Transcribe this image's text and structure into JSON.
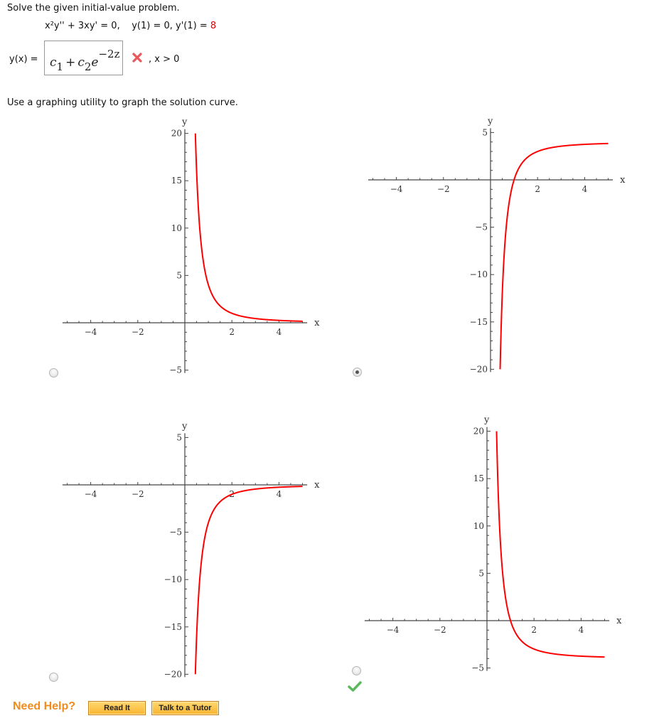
{
  "question": {
    "prompt": "Solve the given initial-value problem.",
    "equation": "x²y'' + 3xy' = 0,",
    "initial_conditions": "y(1) = 0, y'(1) = ",
    "initial_condition_highlight": "8",
    "answer_label": "y(x) =",
    "answer": {
      "c1": "c",
      "c1_sub": "1",
      "plus": "+",
      "c2": "c",
      "c2_sub": "2",
      "base": "e",
      "exponent": "−2z"
    },
    "answer_status": "incorrect",
    "domain_note": ", x > 0",
    "graph_prompt": "Use a graphing utility to graph the solution curve."
  },
  "colors": {
    "curve": "#ff0000",
    "wrong": "#e8585a",
    "correct": "#5cb85c",
    "help_text": "#f08c1e"
  },
  "chart_data": [
    {
      "type": "line",
      "option_index": 1,
      "selected": false,
      "correct": false,
      "function": "y = 4/x^2",
      "xlabel": "x",
      "ylabel": "y",
      "xlim": [
        -5.2,
        5.2
      ],
      "ylim": [
        -5,
        20
      ],
      "x_ticks": [
        -4,
        -2,
        2,
        4
      ],
      "y_ticks": [
        20,
        15,
        10,
        5,
        -5
      ],
      "x_tick_labels": [
        "−4",
        "−2",
        "2",
        "4"
      ],
      "y_tick_labels": [
        "20",
        "15",
        "10",
        "5",
        "−5"
      ],
      "curve_domain": [
        0.447,
        5
      ]
    },
    {
      "type": "line",
      "option_index": 2,
      "selected": true,
      "correct": false,
      "function": "y = 4 - 4/x^2",
      "xlabel": "x",
      "ylabel": "y",
      "xlim": [
        -5.2,
        5.2
      ],
      "ylim": [
        -20,
        5
      ],
      "x_ticks": [
        -4,
        -2,
        2,
        4
      ],
      "y_ticks": [
        5,
        -5,
        -10,
        -15,
        -20
      ],
      "x_tick_labels": [
        "−4",
        "−2",
        "2",
        "4"
      ],
      "y_tick_labels": [
        "5",
        "−5",
        "−10",
        "−15",
        "−20"
      ],
      "curve_domain": [
        0.408,
        5
      ]
    },
    {
      "type": "line",
      "option_index": 3,
      "selected": false,
      "correct": false,
      "function": "y = -4/x^2",
      "xlabel": "x",
      "ylabel": "y",
      "xlim": [
        -5.2,
        5.2
      ],
      "ylim": [
        -20,
        5
      ],
      "x_ticks": [
        -4,
        -2,
        2,
        4
      ],
      "y_ticks": [
        5,
        -5,
        -10,
        -15,
        -20
      ],
      "x_tick_labels": [
        "−4",
        "−2",
        "2",
        "4"
      ],
      "y_tick_labels": [
        "5",
        "−5",
        "−10",
        "−15",
        "−20"
      ],
      "curve_domain": [
        0.447,
        5
      ]
    },
    {
      "type": "line",
      "option_index": 4,
      "selected": false,
      "correct": true,
      "function": "y = -4 + 4/x^2",
      "xlabel": "x",
      "ylabel": "y",
      "xlim": [
        -5.2,
        5.2
      ],
      "ylim": [
        -5,
        20
      ],
      "x_ticks": [
        -4,
        -2,
        2,
        4
      ],
      "y_ticks": [
        20,
        15,
        10,
        5,
        -5
      ],
      "x_tick_labels": [
        "−4",
        "−2",
        "2",
        "4"
      ],
      "y_tick_labels": [
        "20",
        "15",
        "10",
        "5",
        "−5"
      ],
      "curve_domain": [
        0.408,
        5
      ]
    }
  ],
  "help": {
    "label": "Need Help?",
    "read_it": "Read It",
    "talk_to_tutor": "Talk to a Tutor"
  }
}
